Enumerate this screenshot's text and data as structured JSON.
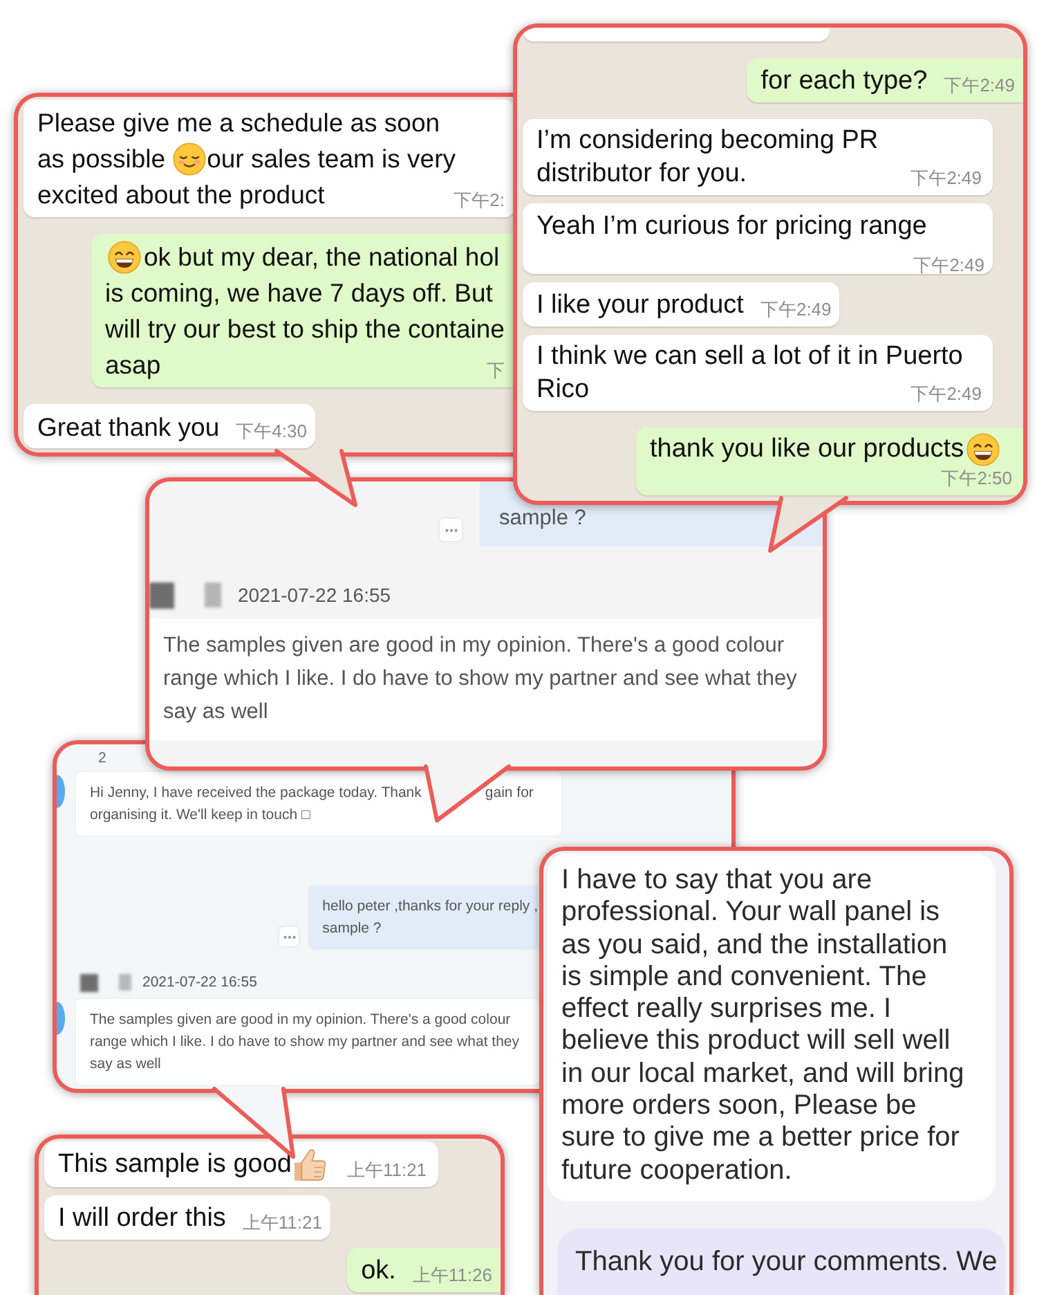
{
  "panels": [
    {
      "kind": "whatsapp",
      "messages": [
        {
          "kind": "in",
          "lines": [
            [
              {
                "kind": "text",
                "text": "Please give me a schedule as soon"
              }
            ],
            [
              {
                "kind": "text",
                "text": "as possible"
              },
              {
                "kind": "smile"
              },
              {
                "kind": "text",
                "text": "our sales team is very"
              }
            ],
            [
              {
                "kind": "text",
                "text": "excited about the product"
              }
            ]
          ],
          "time": "下午2:"
        },
        {
          "kind": "out",
          "lines": [
            [
              {
                "kind": "grin"
              },
              {
                "kind": "text",
                "text": "ok but my dear, the national hol"
              }
            ],
            [
              {
                "kind": "text",
                "text": "is coming, we have 7 days off. But"
              }
            ],
            [
              {
                "kind": "text",
                "text": "will try our best to ship the containe"
              }
            ],
            [
              {
                "kind": "text",
                "text": "asap"
              }
            ]
          ],
          "time": "下"
        },
        {
          "kind": "in",
          "text": "Great thank you",
          "time": "下午4:30"
        }
      ]
    },
    {
      "kind": "whatsapp",
      "messages": [
        {
          "kind": "stub"
        },
        {
          "kind": "out",
          "text": "for each type?",
          "time": "下午2:49"
        },
        {
          "kind": "in",
          "lines": [
            [
              {
                "kind": "text",
                "text": "I’m considering becoming PR"
              }
            ],
            [
              {
                "kind": "text",
                "text": "distributor for you."
              }
            ]
          ],
          "time": "下午2:49"
        },
        {
          "kind": "in",
          "text": "Yeah I’m curious for pricing range",
          "time": "下午2:49"
        },
        {
          "kind": "in",
          "text": "I like your product",
          "time": "下午2:49"
        },
        {
          "kind": "in",
          "lines": [
            [
              {
                "kind": "text",
                "text": "I think we can sell a lot of it in Puerto"
              }
            ],
            [
              {
                "kind": "text",
                "text": "Rico"
              }
            ]
          ],
          "time": "下午2:49"
        },
        {
          "kind": "out",
          "lines": [
            [
              {
                "kind": "text",
                "text": "thank you like our products"
              },
              {
                "kind": "grin"
              }
            ]
          ],
          "time": "下午2:50"
        }
      ]
    },
    {
      "kind": "web-chat",
      "messages": [
        {
          "kind": "out",
          "avatar": false,
          "text": "sample ?"
        },
        {
          "kind": "in",
          "avatar": false,
          "header": "2021-07-22 16:55",
          "text": "The samples given are good in my opinion. There's a good colour range which I like. I do have to show my partner and see what they say as well"
        }
      ]
    },
    {
      "kind": "web-chat",
      "date_label": "2",
      "messages": [
        {
          "kind": "in",
          "avatar": true,
          "lines": [
            [
              {
                "kind": "text",
                "text": "Hi Jenny, I have received the package today. Thank"
              },
              {
                "kind": "text",
                "text": "gain for"
              }
            ],
            [
              {
                "kind": "text",
                "text": "organising it. We'll keep in touch □"
              }
            ]
          ]
        },
        {
          "kind": "out",
          "avatar": false,
          "lines": [
            [
              {
                "kind": "text",
                "text": "hello peter ,thanks for your reply ,"
              }
            ],
            [
              {
                "kind": "text",
                "text": "sample ?"
              }
            ]
          ]
        },
        {
          "kind": "in",
          "avatar": true,
          "header": "2021-07-22 16:55",
          "text": "The samples given are good in my opinion. There's a good colour range which I like. I do have to show my partner and see what they say as well"
        }
      ]
    },
    {
      "kind": "whatsapp",
      "messages": [
        {
          "kind": "in",
          "lines": [
            [
              {
                "kind": "text",
                "text": "This sample is good"
              },
              {
                "kind": "thumb"
              }
            ]
          ],
          "time": "上午11:21"
        },
        {
          "kind": "in",
          "text": "I will order this",
          "time": "上午11:21"
        },
        {
          "kind": "out",
          "text": "ok.",
          "time": "上午11:26"
        }
      ]
    },
    {
      "kind": "review",
      "messages": [
        {
          "kind": "in",
          "text": "I have to say that you are professional. Your wall panel is as you said, and the installation is simple and convenient. The effect really surprises me. I believe this product will sell well in our local market, and will bring more orders soon, Please be sure to give me a better price for future cooperation."
        },
        {
          "kind": "out",
          "text": "Thank you for your comments. We"
        }
      ]
    }
  ]
}
